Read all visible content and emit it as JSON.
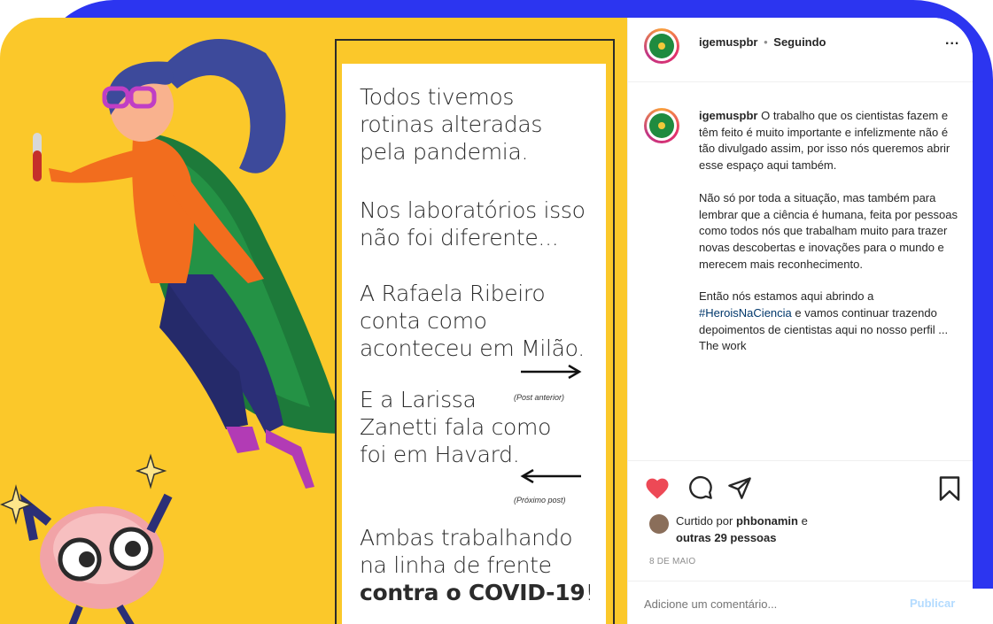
{
  "post_image": {
    "lines_1": "Todos tivemos\nrotinas alteradas\npela pandemia.",
    "lines_2": "Nos laboratórios isso\nnão foi diferente...",
    "lines_3": "A Rafaela Ribeiro\nconta como\naconteceu em Milão.",
    "arrow_1_caption": "(Post anterior)",
    "lines_4": "E a Larissa\nZanetti fala como\nfoi em Havard.",
    "arrow_2_caption": "(Próximo post)",
    "lines_5": "Ambas trabalhando\nna linha de frente",
    "lines_6_bold": "contra o COVID-19",
    "lines_6_end": "!"
  },
  "header": {
    "username": "igemuspbr",
    "separator": "•",
    "follow_state": "Seguindo",
    "more": "..."
  },
  "caption": {
    "username": "igemuspbr",
    "para_1": "O trabalho que os cientistas fazem e têm feito é muito importante e infelizmente não é tão divulgado assim, por isso nós queremos abrir esse espaço aqui também.",
    "para_2": "Não só por toda a situação, mas também para lembrar que a ciência é humana, feita por pessoas como todos nós que trabalham muito para trazer novas descobertas e inovações para o mundo e merecem mais reconhecimento.",
    "para_3_start": "Então nós estamos aqui abrindo a",
    "hashtag": "#HeroisNaCiencia",
    "para_3_end": "e vamos continuar trazendo depoimentos de cientistas aqui no nosso perfil ... The work"
  },
  "likes": {
    "prefix": "Curtido por",
    "user": "phbonamin",
    "suffix": "e",
    "others": "outras 29 pessoas"
  },
  "date": "8 DE MAIO",
  "comment": {
    "placeholder": "Adicione um comentário...",
    "publish": "Publicar"
  },
  "colors": {
    "frame": "#2c35f0",
    "background_image": "#fbc82a",
    "like": "#ed4956",
    "link": "#b3dbff"
  }
}
